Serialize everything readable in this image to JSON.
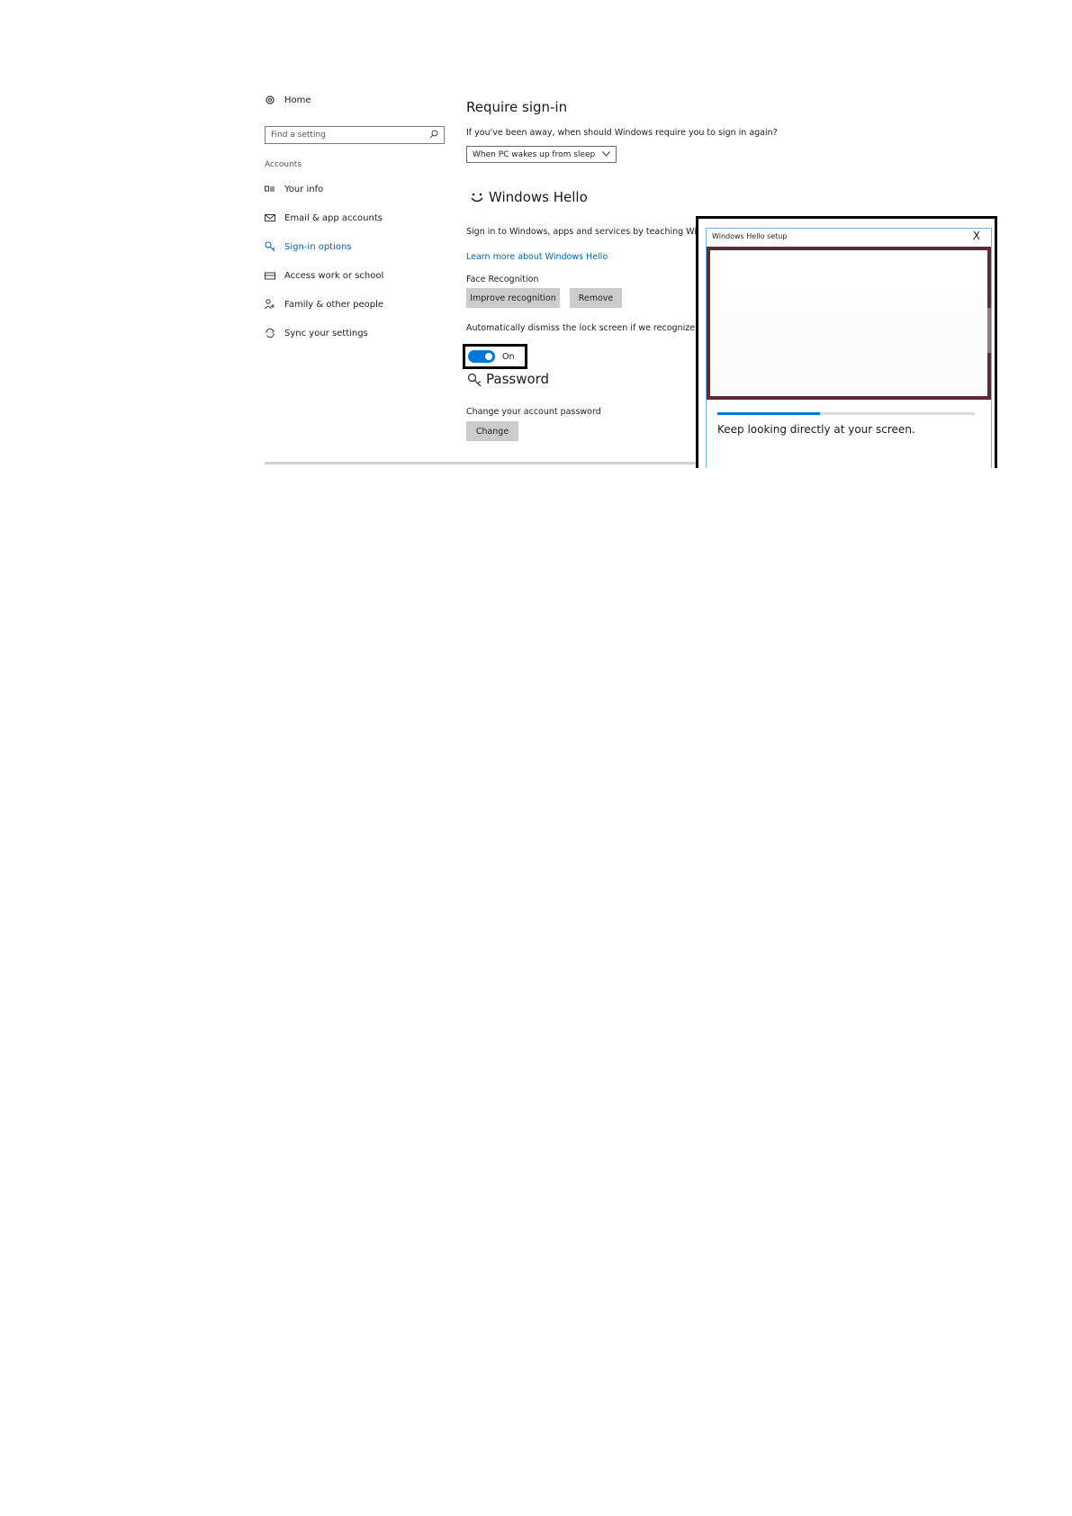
{
  "sidebar": {
    "home": "Home",
    "search_placeholder": "Find a setting",
    "section": "Accounts",
    "items": [
      {
        "label": "Your info"
      },
      {
        "label": "Email & app accounts"
      },
      {
        "label": "Sign-in options"
      },
      {
        "label": "Access work or school"
      },
      {
        "label": "Family & other people"
      },
      {
        "label": "Sync your settings"
      }
    ]
  },
  "main": {
    "require_signin": {
      "title": "Require sign-in",
      "question": "If you've been away, when should Windows require you to sign in again?",
      "selected": "When PC wakes up from sleep"
    },
    "hello": {
      "title": "Windows Hello",
      "description": "Sign in to Windows, apps and services by teaching Window",
      "learn_more": "Learn more about Windows Hello",
      "face_label": "Face Recognition",
      "improve_button": "Improve recognition",
      "remove_button": "Remove",
      "auto_dismiss": "Automatically dismiss the lock screen if we recognize your",
      "toggle_state": "On"
    },
    "password": {
      "title": "Password",
      "description": "Change your account password",
      "change_button": "Change"
    }
  },
  "dialog": {
    "title": "Windows Hello setup",
    "close": "X",
    "progress": 0.4,
    "message": "Keep looking directly at your screen."
  },
  "colors": {
    "accent": "#0078d7",
    "link": "#0063b1",
    "camera_border": "#5c2a3a"
  }
}
